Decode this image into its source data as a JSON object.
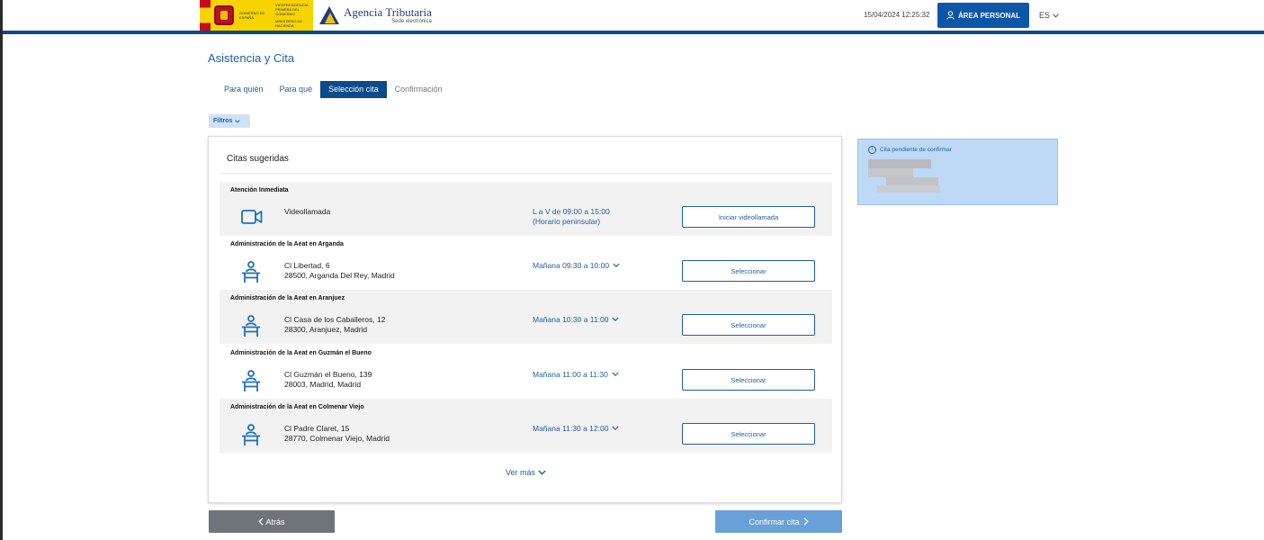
{
  "header": {
    "gov_text": "VICEPRESIDENCIA PRIMERA DEL GOBIERNO",
    "gov_left": "GOBIERNO DE ESPAÑA",
    "ministry": "MINISTERIO DE HACIENDA",
    "brand_name": "Agencia Tributaria",
    "brand_sub": "Sede electrónica",
    "datetime": "15/04/2024 12:25:32",
    "area_personal_label": "ÁREA PERSONAL",
    "language": "ES"
  },
  "page": {
    "title": "Asistencia y Cita",
    "steps": [
      {
        "label": "Para quién",
        "state": "done"
      },
      {
        "label": "Para qué",
        "state": "done"
      },
      {
        "label": "Selección cita",
        "state": "active"
      },
      {
        "label": "Confirmación",
        "state": "disabled"
      }
    ],
    "filters_label": "Filtros"
  },
  "citas": {
    "title": "Citas sugeridas",
    "offices": [
      {
        "name": "Atención Inmediata",
        "addr1": "Videollamada",
        "addr2": "",
        "slot1": "L a V de 09:00 a 15:00",
        "slot2": "(Horario peninsular)",
        "button": "Iniciar videollamada",
        "icon": "video-camera-icon"
      },
      {
        "name": "Administración de la Aeat en Arganda",
        "addr1": "Cl Libertad, 6",
        "addr2": "28500, Arganda Del Rey, Madrid",
        "slot1": "Mañana 09:30 a 10:00",
        "slot2": "",
        "button": "Seleccionar",
        "icon": "office-desk-icon"
      },
      {
        "name": "Administración de la Aeat en Aranjuez",
        "addr1": "Cl Casa de los Caballeros, 12",
        "addr2": "28300, Aranjuez, Madrid",
        "slot1": "Mañana 10:30 a 11:00",
        "slot2": "",
        "button": "Seleccionar",
        "icon": "office-desk-icon"
      },
      {
        "name": "Administración de la Aeat en Guzmán el Bueno",
        "addr1": "Cl Guzmán el Bueno, 139",
        "addr2": "28003, Madrid, Madrid",
        "slot1": "Mañana 11:00 a 11:30",
        "slot2": "",
        "button": "Seleccionar",
        "icon": "office-desk-icon"
      },
      {
        "name": "Administración de la Aeat en Colmenar Viejo",
        "addr1": "Cl Padre Claret, 15",
        "addr2": "28770, Colmenar Viejo, Madrid",
        "slot1": "Mañana 11:30 a 12:00",
        "slot2": "",
        "button": "Seleccionar",
        "icon": "office-desk-icon"
      }
    ],
    "ver_mas": "Ver más"
  },
  "nav": {
    "back_label": "Atrás",
    "confirm_label": "Confirmar cita"
  },
  "pending": {
    "title": "Cita pendiente de confirmar"
  },
  "colors": {
    "primary": "#0b4a8b",
    "link": "#1f5fa5",
    "pending_bg": "#bdd9f5",
    "confirm_disabled": "#6aa0d8",
    "back": "#6f747b"
  }
}
